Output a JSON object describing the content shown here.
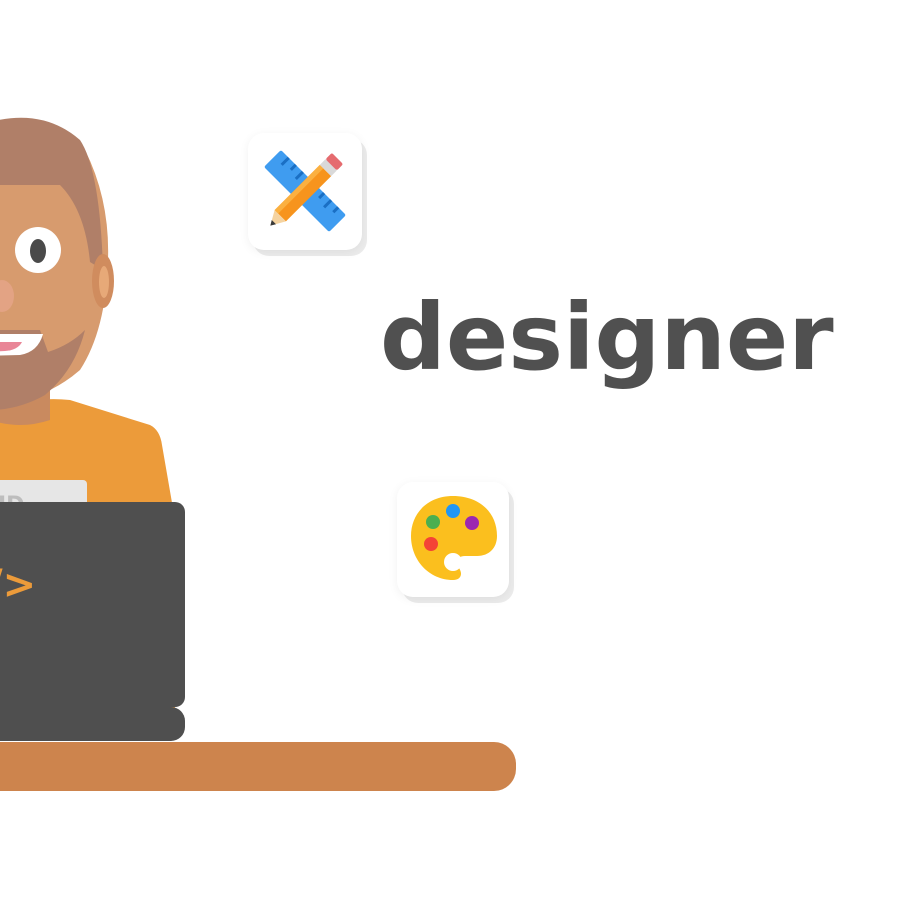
{
  "headline": {
    "text": "designer"
  },
  "laptop": {
    "code_symbol": "/>"
  },
  "badge": {
    "text": "ID"
  },
  "icons": {
    "ruler_pencil": "ruler-pencil-icon",
    "palette": "palette-icon"
  },
  "colors": {
    "background": "#ffffff",
    "headline": "#505050",
    "skin": "#D79B6E",
    "hair_beard": "#B07F68",
    "shirt": "#EC9B3A",
    "laptop": "#4F4F4F",
    "desk": "#CD844D",
    "code_symbol": "#EC9B3A"
  }
}
